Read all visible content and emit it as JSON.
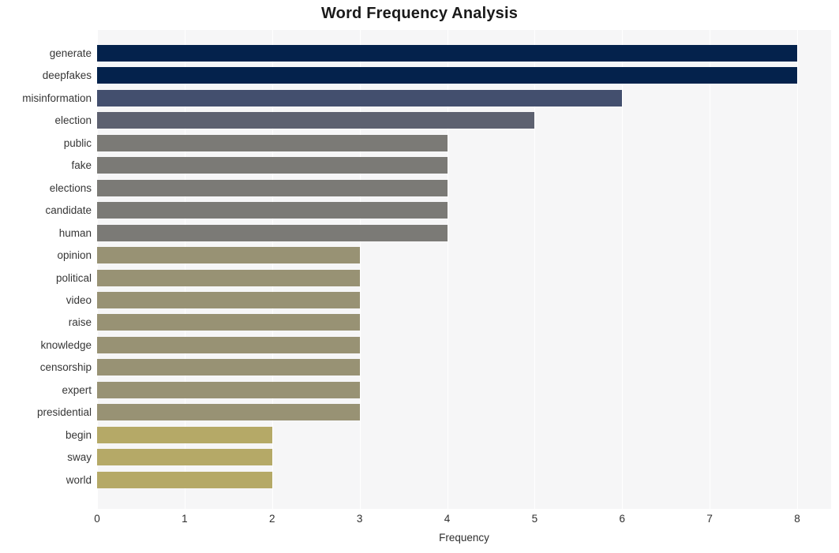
{
  "chart_data": {
    "type": "bar",
    "orientation": "horizontal",
    "title": "Word Frequency Analysis",
    "xlabel": "Frequency",
    "ylabel": "",
    "xlim": [
      0,
      8
    ],
    "xticks": [
      0,
      1,
      2,
      3,
      4,
      5,
      6,
      7,
      8
    ],
    "xtick_labels": [
      "0",
      "1",
      "2",
      "3",
      "4",
      "5",
      "6",
      "7",
      "8"
    ],
    "grid": true,
    "grid_axis": "x",
    "grid_color": "#ffffff",
    "plot_background": "#f6f6f7",
    "figure_background": "#ffffff",
    "legend": null,
    "categories": [
      "generate",
      "deepfakes",
      "misinformation",
      "election",
      "public",
      "fake",
      "elections",
      "candidate",
      "human",
      "opinion",
      "political",
      "video",
      "raise",
      "knowledge",
      "censorship",
      "expert",
      "presidential",
      "begin",
      "sway",
      "world"
    ],
    "values": [
      8,
      8,
      6,
      5,
      4,
      4,
      4,
      4,
      4,
      3,
      3,
      3,
      3,
      3,
      3,
      3,
      3,
      2,
      2,
      2
    ],
    "bar_colors": [
      "#04224c",
      "#04224c",
      "#434f6e",
      "#5d6170",
      "#7b7a76",
      "#7b7a76",
      "#7b7a76",
      "#7b7a76",
      "#7b7a76",
      "#989274",
      "#989274",
      "#989274",
      "#989274",
      "#989274",
      "#989274",
      "#989274",
      "#989274",
      "#b5a967",
      "#b5a967",
      "#b5a967"
    ]
  }
}
